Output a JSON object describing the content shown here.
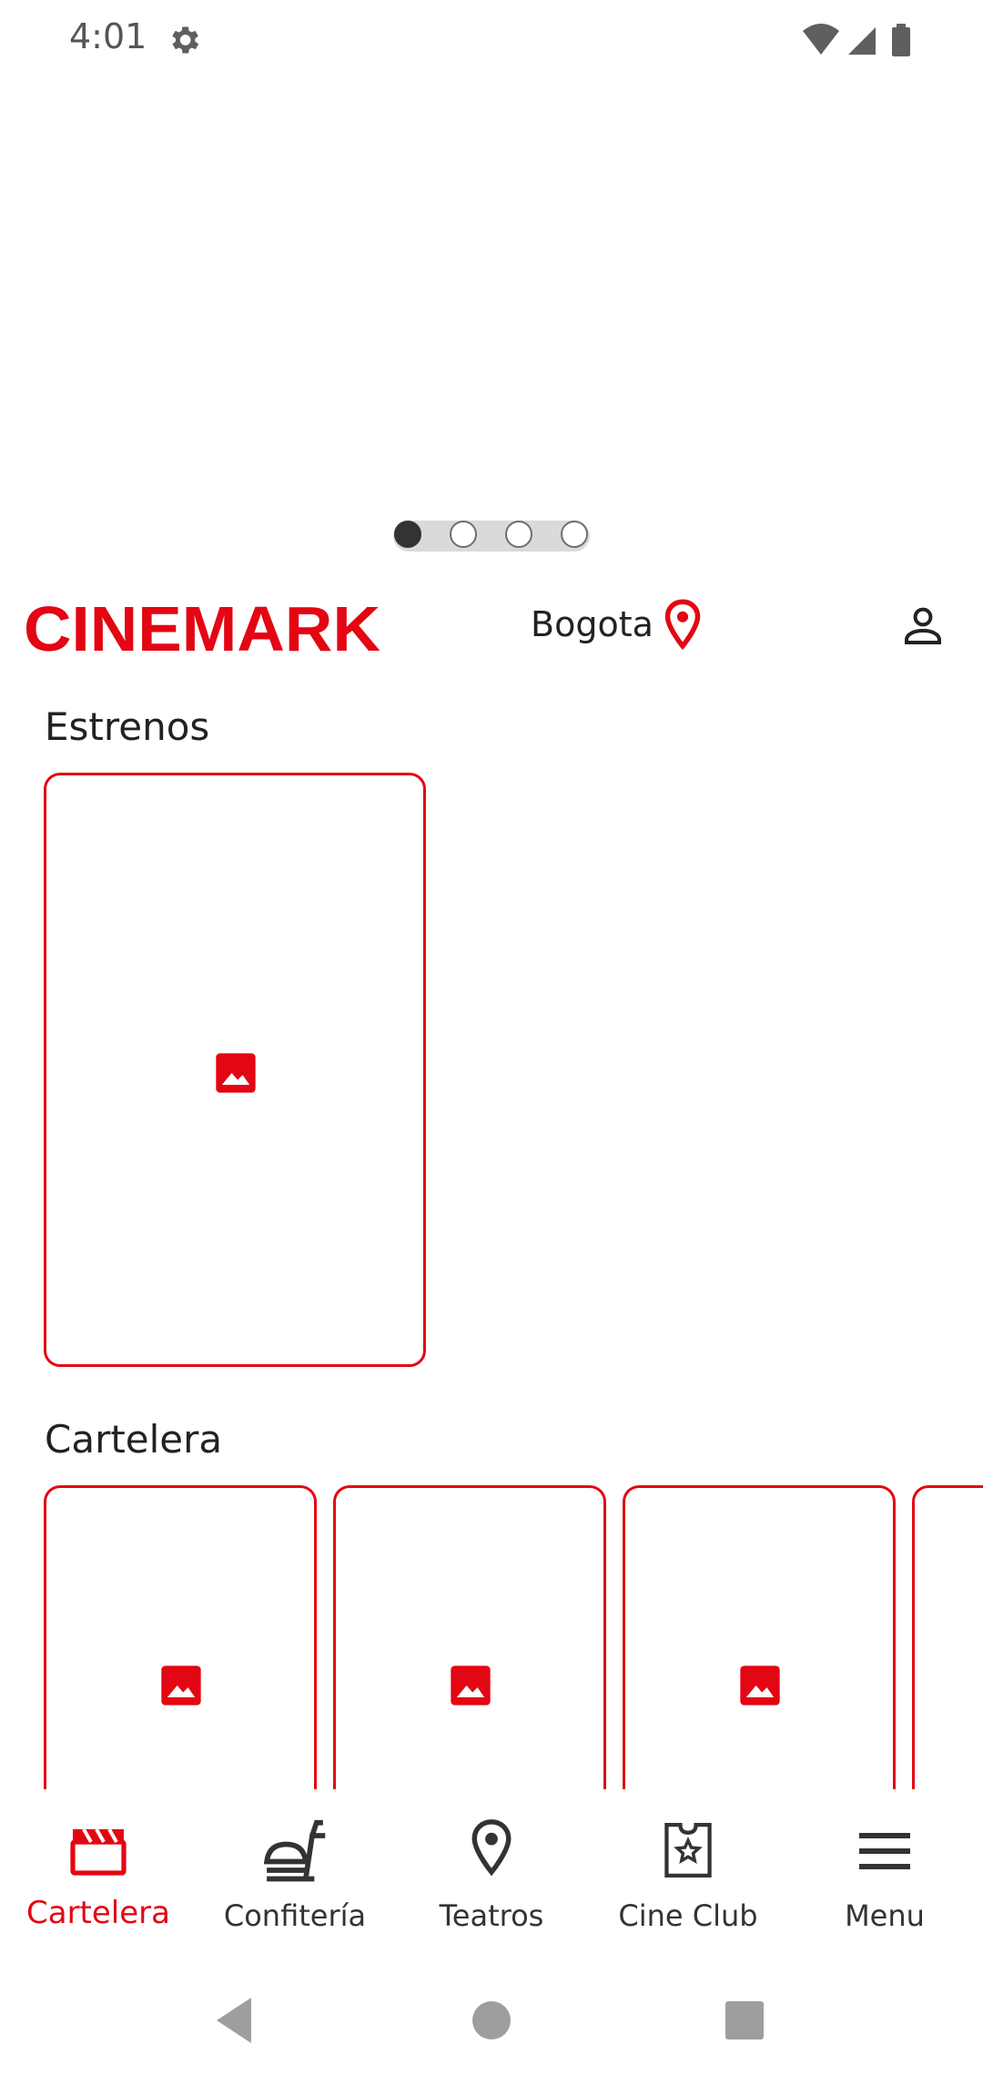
{
  "status_bar": {
    "time": "4:01",
    "icons": [
      "settings-icon",
      "wifi-icon",
      "signal-icon",
      "battery-icon"
    ]
  },
  "carousel": {
    "pages": 4,
    "active_index": 0
  },
  "header": {
    "logo_text": "CINEMARK",
    "city": "Bogota",
    "icons": [
      "location-pin-icon",
      "account-icon"
    ]
  },
  "sections": {
    "estrenos": {
      "title": "Estrenos",
      "posters": 1
    },
    "cartelera": {
      "title": "Cartelera",
      "posters": 4
    }
  },
  "bottom_nav": {
    "items": [
      {
        "label": "Cartelera",
        "icon": "clapperboard-icon",
        "active": true
      },
      {
        "label": "Confitería",
        "icon": "food-icon",
        "active": false
      },
      {
        "label": "Teatros",
        "icon": "location-pin-icon",
        "active": false
      },
      {
        "label": "Cine Club",
        "icon": "ticket-star-icon",
        "active": false
      },
      {
        "label": "Menu",
        "icon": "hamburger-icon",
        "active": false
      }
    ]
  },
  "colors": {
    "brand_red": "#e30613",
    "text_dark": "#222222",
    "icon_gray": "#333333"
  }
}
